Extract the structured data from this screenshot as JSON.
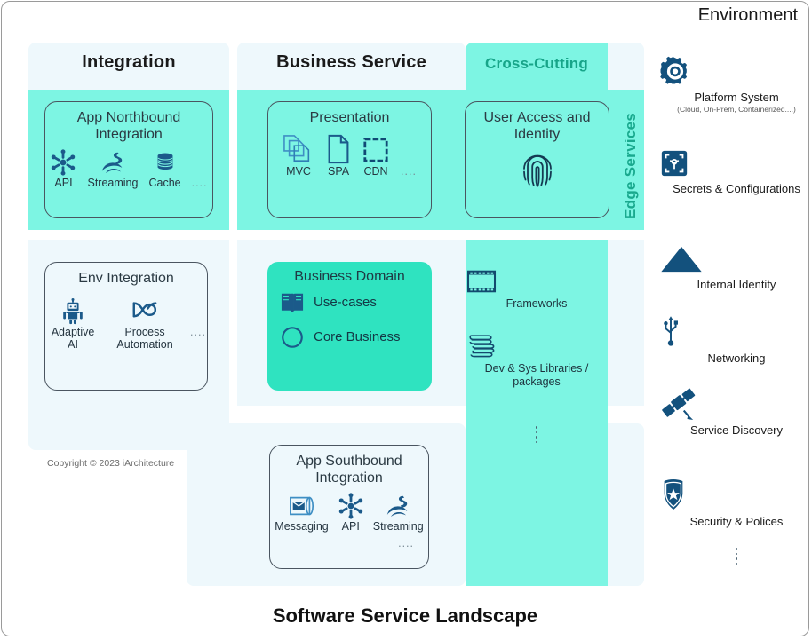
{
  "diagram": {
    "bottom_title": "Software Service Landscape",
    "copyright": "Copyright © 2023 iArchitecture",
    "environment_title": "Environment",
    "edge_services_label": "Edge Services",
    "colors": {
      "band_light": "#eef8fc",
      "band_teal": "#7df5e3",
      "card_solid": "#2fe3c0",
      "icon_navy": "#1b5a8a",
      "icon_deep": "#104a75",
      "accent_green": "#17a589",
      "text_dark": "#1a1a1a"
    }
  },
  "columns": [
    {
      "id": "integration",
      "label": "Integration"
    },
    {
      "id": "business-service",
      "label": "Business Service"
    },
    {
      "id": "cross-cutting",
      "label": "Cross-Cutting"
    }
  ],
  "cards": {
    "app_northbound": {
      "title": "App Northbound Integration",
      "items": [
        {
          "label": "API",
          "icon": "api-asterisk-icon"
        },
        {
          "label": "Streaming",
          "icon": "stream-river-icon"
        },
        {
          "label": "Cache",
          "icon": "cache-database-icon"
        }
      ],
      "more": "...."
    },
    "env_integration": {
      "title": "Env Integration",
      "items": [
        {
          "label": "Adaptive AI",
          "icon": "robot-icon"
        },
        {
          "label": "Process Automation",
          "icon": "process-automation-icon"
        }
      ],
      "more": "...."
    },
    "presentation": {
      "title": "Presentation",
      "items": [
        {
          "label": "MVC",
          "icon": "stacked-pages-icon"
        },
        {
          "label": "SPA",
          "icon": "page-icon"
        },
        {
          "label": "CDN",
          "icon": "square-dashed-icon"
        }
      ],
      "more": "...."
    },
    "business_domain": {
      "title": "Business Domain",
      "items": [
        {
          "label": "Use-cases",
          "icon": "open-book-icon"
        },
        {
          "label": "Core Business",
          "icon": "circle-icon"
        }
      ]
    },
    "app_southbound": {
      "title": "App Southbound Integration",
      "items": [
        {
          "label": "Messaging",
          "icon": "message-envelope-icon"
        },
        {
          "label": "API",
          "icon": "api-asterisk-icon"
        },
        {
          "label": "Streaming",
          "icon": "stream-river-icon"
        }
      ],
      "more": "...."
    },
    "user_access": {
      "title": "User Access and Identity",
      "icon": "fingerprint-icon"
    }
  },
  "cross_cutting_items": [
    {
      "label": "Frameworks",
      "icon": "film-strip-icon"
    },
    {
      "label": "Dev & Sys Libraries / packages",
      "icon": "books-stack-icon"
    },
    {
      "label": "",
      "icon": "vertical-ellipsis-icon"
    }
  ],
  "environment_items": [
    {
      "label": "Platform System",
      "sublabel": "(Cloud, On-Prem, Containerized....)",
      "icon": "gear-icon"
    },
    {
      "label": "Secrets & Configurations",
      "sublabel": "",
      "icon": "secrets-key-icon"
    },
    {
      "label": "Internal Identity",
      "sublabel": "",
      "icon": "triangle-icon"
    },
    {
      "label": "Networking",
      "sublabel": "",
      "icon": "usb-network-icon"
    },
    {
      "label": "Service Discovery",
      "sublabel": "",
      "icon": "satellite-icon"
    },
    {
      "label": "Security & Polices",
      "sublabel": "",
      "icon": "shield-badge-icon"
    },
    {
      "label": "",
      "sublabel": "",
      "icon": "vertical-ellipsis-icon"
    }
  ]
}
